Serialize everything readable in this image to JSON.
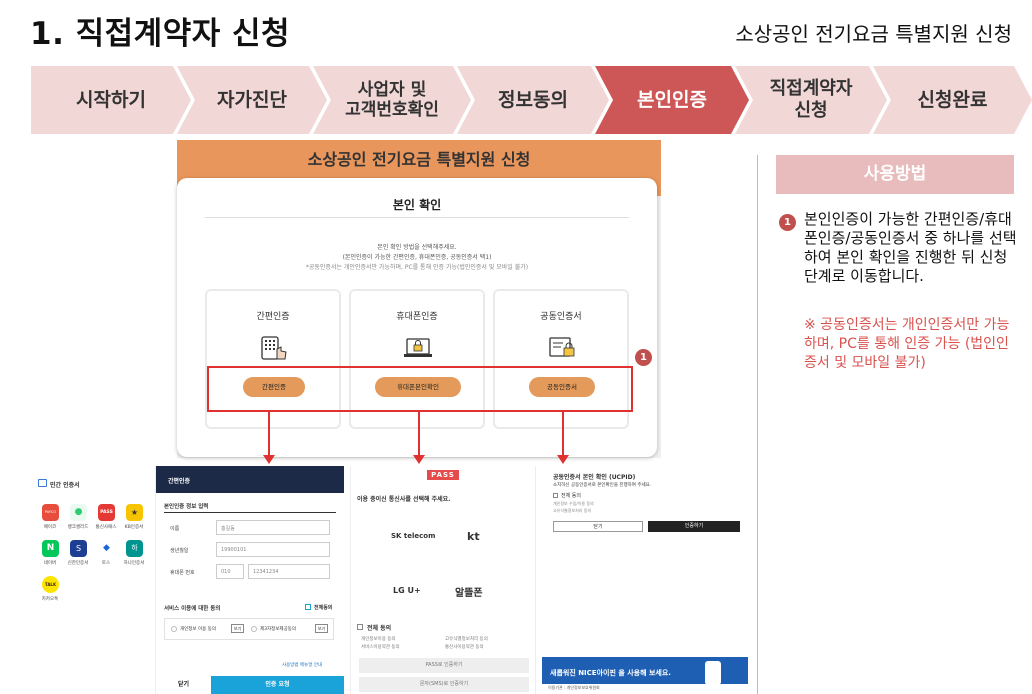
{
  "header": {
    "title": "1. 직접계약자 신청",
    "subtitle": "소상공인 전기요금 특별지원 신청"
  },
  "steps": [
    {
      "label": "시작하기",
      "active": false
    },
    {
      "label": "자가진단",
      "active": false
    },
    {
      "label": "사업자 및\n고객번호확인",
      "active": false
    },
    {
      "label": "정보동의",
      "active": false
    },
    {
      "label": "본인인증",
      "active": true
    },
    {
      "label": "직접계약자\n신청",
      "active": false
    },
    {
      "label": "신청완료",
      "active": false
    }
  ],
  "colors": {
    "step_inactive": "#f2d7d7",
    "step_active": "#cd5657",
    "accent": "#c0504d",
    "highlight_red": "#e03131",
    "orange_button": "#e39a5a",
    "guide_header": "#e8bcbc"
  },
  "auth_screen": {
    "banner": "소상공인 전기요금 특별지원 신청",
    "card_title": "본인 확인",
    "desc_line1": "본인 확인 방법을 선택해주세요.",
    "desc_line2": "(본인인증이 가능한 간편인증, 휴대폰인증, 공동인증서 택1)",
    "desc_line3": "*공동인증서는 개인인증서만 가능하며, PC를 통해 인증 가능(법인인증서 및 모바일 불가)",
    "methods": [
      {
        "label": "간편인증",
        "button": "간편인증",
        "icon": "keypad-hand-icon"
      },
      {
        "label": "휴대폰인증",
        "button": "휴대폰본인확인",
        "icon": "laptop-lock-icon"
      },
      {
        "label": "공동인증서",
        "button": "공동인증서",
        "icon": "certificate-lock-icon"
      }
    ],
    "marker": "1"
  },
  "panel_simple": {
    "title": "민간 인증서",
    "apps": [
      {
        "name": "페이코",
        "color": "#e74c3c",
        "glyph": "PAYCO"
      },
      {
        "name": "뱅크샐러드",
        "color": "#2ecc71",
        "glyph": "●"
      },
      {
        "name": "통신사패스",
        "color": "#e53935",
        "glyph": "PASS"
      },
      {
        "name": "KB인증서",
        "color": "#f6c400",
        "glyph": "★"
      },
      {
        "name": "네이버",
        "color": "#03c75a",
        "glyph": "N"
      },
      {
        "name": "신한인증서",
        "color": "#1c3f94",
        "glyph": "S"
      },
      {
        "name": "토스",
        "color": "#1b64da",
        "glyph": "◆"
      },
      {
        "name": "하나인증서",
        "color": "#009490",
        "glyph": "하"
      },
      {
        "name": "카카오톡",
        "color": "#fee500",
        "glyph": "TALK"
      }
    ],
    "form_title": "간편인증",
    "section_input": "본인인증 정보 입력",
    "name_label": "이름",
    "name_value": "홍길동",
    "birth_label": "생년월일",
    "birth_value": "19900101",
    "phone_label": "휴대폰 번호",
    "phone_prefix": "010",
    "phone_value": "12341234",
    "agree_title": "서비스 이용에 대한 동의",
    "agree_all": "전체동의",
    "agree_item1": "개인정보 이용 동의",
    "agree_item2": "제3자정보제공동의",
    "view_label": "보기",
    "help_link": "사용방법 메뉴얼 안내",
    "close_label": "닫기",
    "request_label": "인증 요청"
  },
  "panel_pass": {
    "logo": "PASS",
    "prompt": "이용 중이신 통신사를 선택해 주세요.",
    "carriers": [
      "SK telecom",
      "kt",
      "LG U+",
      "알뜰폰"
    ],
    "agree_all": "전체 동의",
    "agree_items": [
      "개인정보이용 동의",
      "고유식별정보처리 동의",
      "서비스이용약관 동의",
      "통신사이용약관 동의"
    ],
    "btn_pass": "PASS로 인증하기",
    "btn_sms": "문자(SMS)로 인증하기"
  },
  "panel_cert": {
    "title": "공동인증서 본인 확인 (UCPID)",
    "subtitle": "소지하신 공동인증서로 본인확인을 진행하여 주세요.",
    "agree_all": "전체 동의",
    "agree_items": [
      "개인정보 수집/이용 동의",
      "고유식별정보처리 동의"
    ],
    "close": "닫기",
    "confirm": "인증하기"
  },
  "panel_nice": {
    "banner": "새롭워진 NICE아이핀 을 사용해 보세요.",
    "footer": "이용기관 : 개인정보보호위원회"
  },
  "guide": {
    "header": "사용방법",
    "marker": "1",
    "text": "본인인증이 가능한 간편인증/휴대폰인증/공동인증서 중 하나를 선택하여 본인 확인을 진행한 뒤 신청단계로 이동합니다.",
    "note": "※ 공동인증서는 개인인증서만 가능하며, PC를 통해 인증 가능 (법인인증서 및 모바일 불가)"
  }
}
